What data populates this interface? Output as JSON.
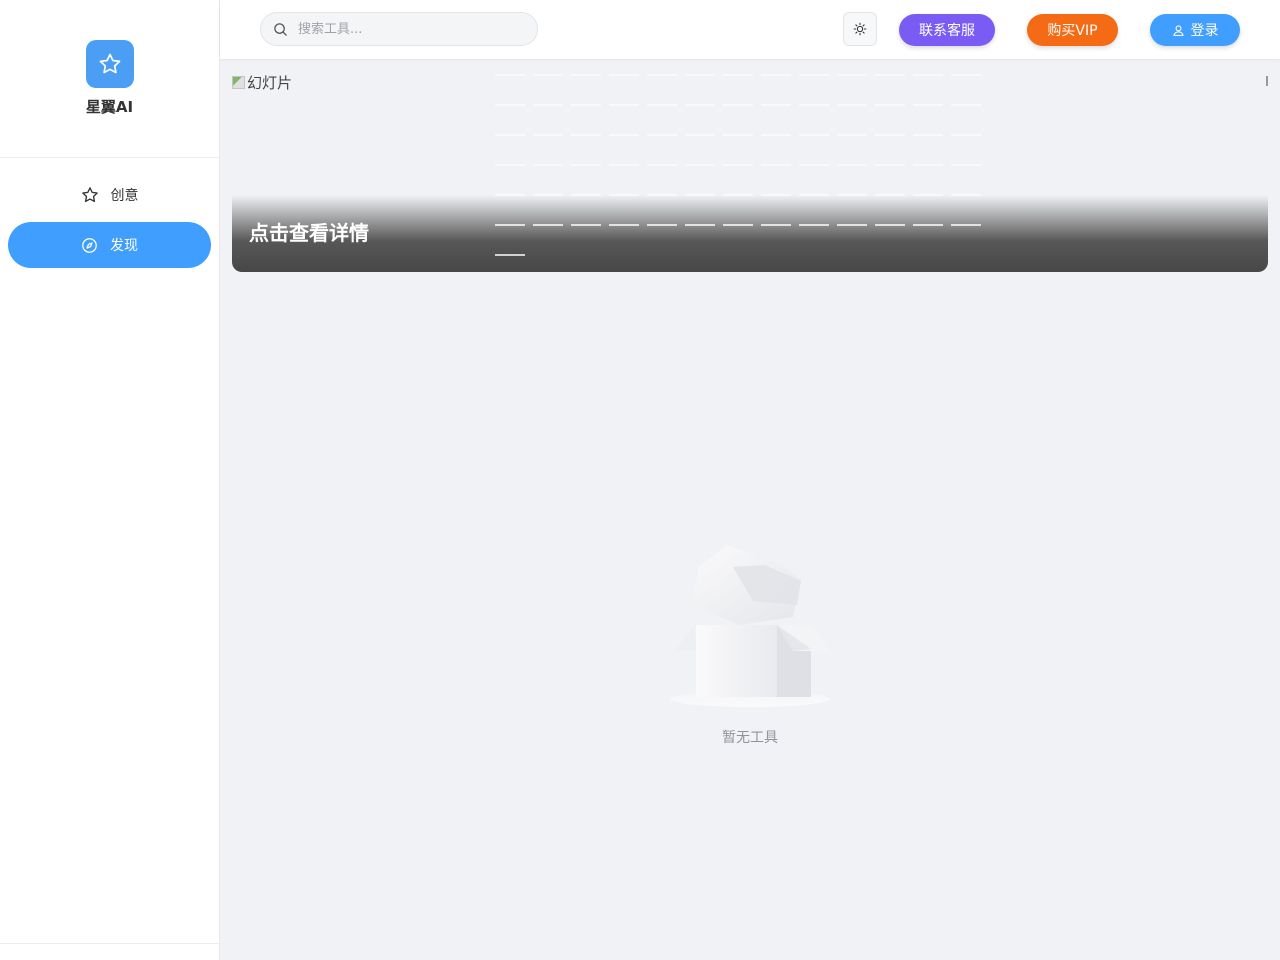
{
  "sidebar": {
    "brand": "星翼AI",
    "nav": [
      {
        "label": "创意",
        "icon": "star-icon",
        "active": false
      },
      {
        "label": "发现",
        "icon": "compass-icon",
        "active": true
      }
    ]
  },
  "header": {
    "search_placeholder": "搜索工具...",
    "theme_icon": "sun-icon",
    "service_label": "联系客服",
    "vip_label": "购买VIP",
    "login_label": "登录"
  },
  "banner": {
    "image_alt": "幻灯片",
    "caption": "点击查看详情"
  },
  "empty": {
    "text": "暂无工具"
  },
  "colors": {
    "primary": "#409eff",
    "service": "#7a5cf5",
    "vip": "#f56a14",
    "logo": "#4a9ff5"
  }
}
